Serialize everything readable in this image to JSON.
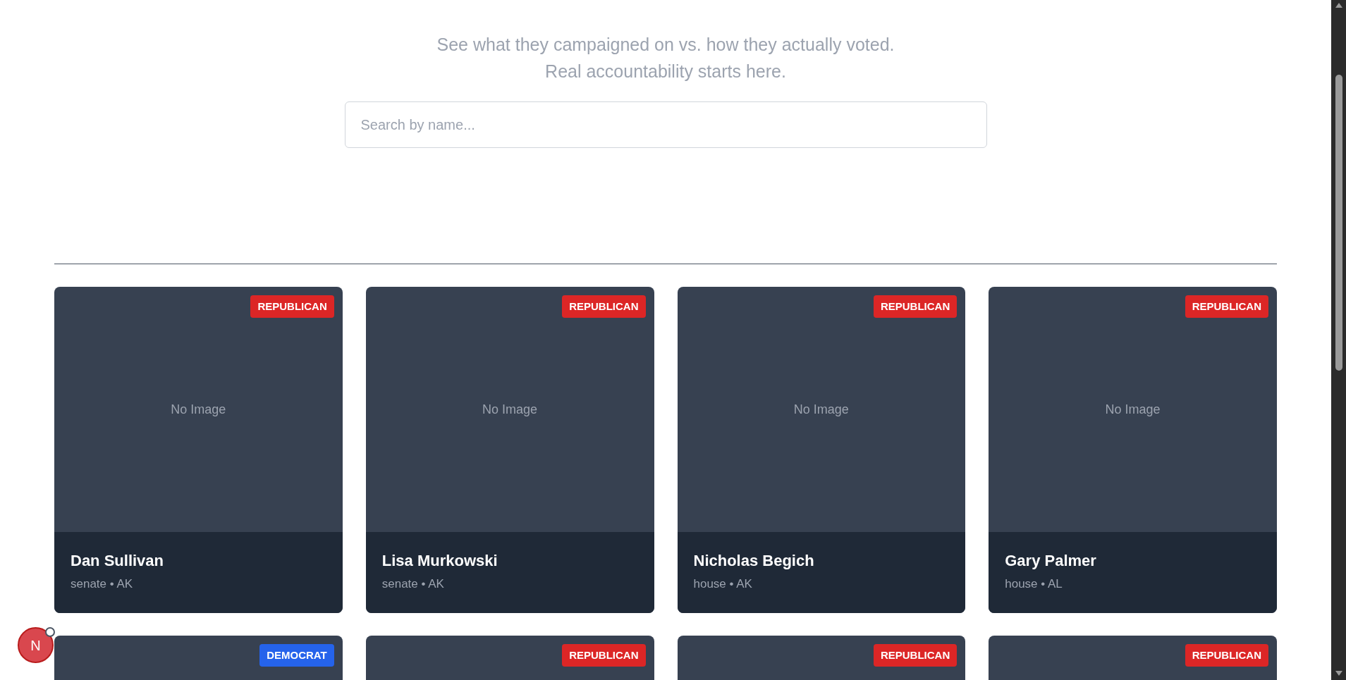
{
  "tagline": [
    "See what they campaigned on vs. how they actually voted.",
    "Real accountability starts here."
  ],
  "search": {
    "placeholder": "Search by name..."
  },
  "cards": [
    {
      "party": "REPUBLICAN",
      "color": "#dc2626",
      "placeholder": "No Image",
      "name": "Dan Sullivan",
      "meta": "senate • AK"
    },
    {
      "party": "REPUBLICAN",
      "color": "#dc2626",
      "placeholder": "No Image",
      "name": "Lisa Murkowski",
      "meta": "senate • AK"
    },
    {
      "party": "REPUBLICAN",
      "color": "#dc2626",
      "placeholder": "No Image",
      "name": "Nicholas Begich",
      "meta": "house • AK"
    },
    {
      "party": "REPUBLICAN",
      "color": "#dc2626",
      "placeholder": "No Image",
      "name": "Gary Palmer",
      "meta": "house • AL"
    },
    {
      "party": "DEMOCRAT",
      "color": "#2563eb"
    },
    {
      "party": "REPUBLICAN",
      "color": "#dc2626"
    },
    {
      "party": "REPUBLICAN",
      "color": "#dc2626"
    },
    {
      "party": "REPUBLICAN",
      "color": "#dc2626"
    }
  ],
  "floating_badge": {
    "letter": "N"
  }
}
